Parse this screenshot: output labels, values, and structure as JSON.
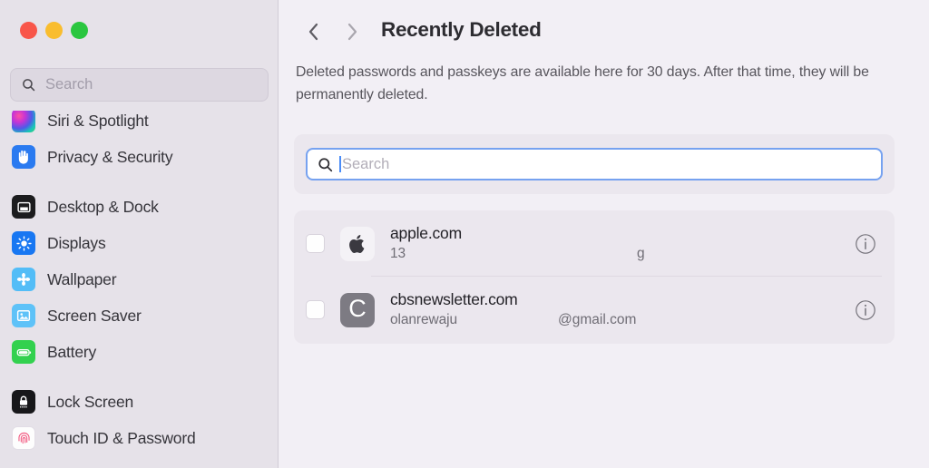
{
  "window": {
    "traffic_lights": [
      {
        "name": "close",
        "color": "#f8564a"
      },
      {
        "name": "minimize",
        "color": "#f9bd2e"
      },
      {
        "name": "maximize",
        "color": "#2ac63f"
      }
    ]
  },
  "sidebar": {
    "search": {
      "placeholder": "Search",
      "value": "",
      "icon": "search-icon"
    },
    "items": [
      {
        "label": "Siri & Spotlight",
        "icon": "siri-icon",
        "key": "siri"
      },
      {
        "label": "Privacy & Security",
        "icon": "hand-icon",
        "key": "privacy"
      },
      {
        "label": "Desktop & Dock",
        "icon": "desktop-icon",
        "key": "desktop"
      },
      {
        "label": "Displays",
        "icon": "brightness-icon",
        "key": "displays"
      },
      {
        "label": "Wallpaper",
        "icon": "flower-icon",
        "key": "wallpaper"
      },
      {
        "label": "Screen Saver",
        "icon": "screensaver-icon",
        "key": "screensaver"
      },
      {
        "label": "Battery",
        "icon": "battery-icon",
        "key": "battery"
      },
      {
        "label": "Lock Screen",
        "icon": "padlock-icon",
        "key": "lockscreen"
      },
      {
        "label": "Touch ID & Password",
        "icon": "fingerprint-icon",
        "key": "touchid"
      }
    ]
  },
  "header": {
    "back_icon": "chevron-left-icon",
    "forward_icon": "chevron-right-icon",
    "title": "Recently Deleted",
    "description": "Deleted passwords and passkeys are available here for 30 days. After that time, they will be permanently deleted."
  },
  "search": {
    "placeholder": "Search",
    "value": "",
    "icon": "search-icon",
    "focused": true,
    "focus_ring_color": "#76a2f0"
  },
  "list": {
    "rows": [
      {
        "title": "apple.com",
        "subtitle": "13",
        "subtitle_extra": "g",
        "icon": "apple-logo-icon",
        "icon_letter": "",
        "checked": false,
        "info_icon": "info-circle-icon"
      },
      {
        "title": "cbsnewsletter.com",
        "subtitle": "olanrewaju",
        "subtitle_extra": "@gmail.com",
        "icon": "letter-avatar-icon",
        "icon_letter": "C",
        "checked": false,
        "info_icon": "info-circle-icon"
      }
    ]
  },
  "annotation": {
    "type": "arrow",
    "color": "#f5391c",
    "direction": "right",
    "points_to": "info-button-row-1"
  }
}
